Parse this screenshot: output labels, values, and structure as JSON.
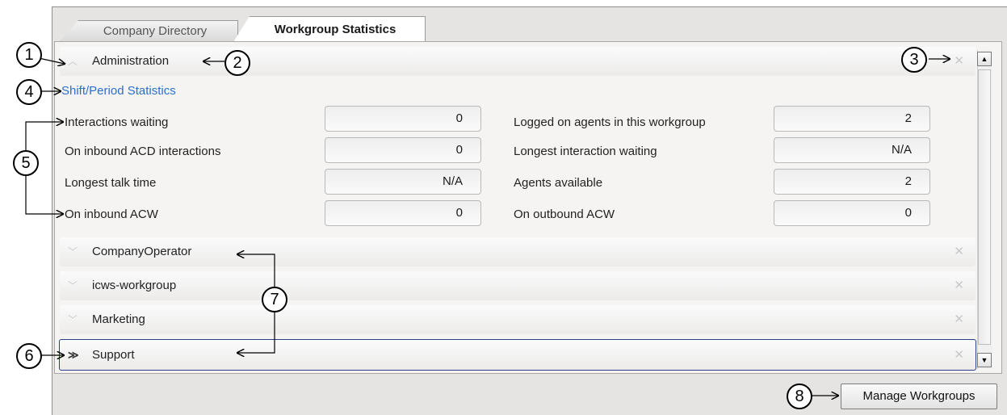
{
  "tabs": [
    {
      "label": "Company Directory",
      "active": false
    },
    {
      "label": "Workgroup Statistics",
      "active": true
    }
  ],
  "expanded_group": {
    "name": "Administration",
    "section_title": "Shift/Period Statistics",
    "stats_left": [
      {
        "label": "Interactions waiting",
        "value": "0"
      },
      {
        "label": "On inbound ACD interactions",
        "value": "0"
      },
      {
        "label": "Longest talk time",
        "value": "N/A"
      },
      {
        "label": "On inbound ACW",
        "value": "0"
      }
    ],
    "stats_right": [
      {
        "label": "Logged on agents in this workgroup",
        "value": "2"
      },
      {
        "label": "Longest interaction waiting",
        "value": "N/A"
      },
      {
        "label": "Agents available",
        "value": "2"
      },
      {
        "label": "On outbound ACW",
        "value": "0"
      }
    ]
  },
  "collapsed_groups": [
    {
      "name": "CompanyOperator"
    },
    {
      "name": "icws-workgroup"
    },
    {
      "name": "Marketing"
    },
    {
      "name": "Support",
      "selected": true
    }
  ],
  "icons": {
    "collapse": "chevron-up-icon",
    "expand": "chevron-down-icon",
    "close": "close-icon"
  },
  "manage_button_label": "Manage Workgroups",
  "callouts": [
    "1",
    "2",
    "3",
    "4",
    "5",
    "6",
    "7",
    "8"
  ],
  "colors": {
    "section_title": "#2a6fd0",
    "selected_border": "#2b3f87"
  }
}
